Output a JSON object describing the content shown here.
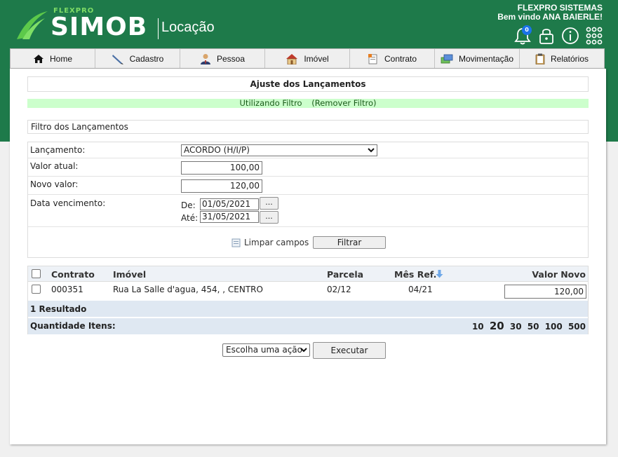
{
  "header": {
    "brand_small": "FLEXPRO",
    "brand_name": "SIMOB",
    "brand_sub": "Locação",
    "company": "FLEXPRO SISTEMAS",
    "welcome": "Bem vindo ANA BAIERLE!",
    "notifications_count": "0",
    "icons": [
      "bell-icon",
      "lock-icon",
      "info-icon",
      "apps-grid-icon"
    ]
  },
  "nav": {
    "items": [
      {
        "label": "Home",
        "icon": "home-icon"
      },
      {
        "label": "Cadastro",
        "icon": "pen-icon"
      },
      {
        "label": "Pessoa",
        "icon": "person-icon"
      },
      {
        "label": "Imóvel",
        "icon": "house-icon"
      },
      {
        "label": "Contrato",
        "icon": "document-icon"
      },
      {
        "label": "Movimentação",
        "icon": "money-icon"
      },
      {
        "label": "Relatórios",
        "icon": "clipboard-icon"
      }
    ]
  },
  "page": {
    "title": "Ajuste dos Lançamentos",
    "filter_status": "Utilizando Filtro",
    "remove_filter": "(Remover Filtro)",
    "section_title": "Filtro dos Lançamentos"
  },
  "form": {
    "lancamento_label": "Lançamento:",
    "lancamento_value": "ACORDO (H/I/P)",
    "valor_atual_label": "Valor atual:",
    "valor_atual_value": "100,00",
    "novo_valor_label": "Novo valor:",
    "novo_valor_value": "120,00",
    "data_venc_label": "Data vencimento:",
    "de_label": "De:",
    "de_value": "01/05/2021",
    "ate_label": "Até:",
    "ate_value": "31/05/2021",
    "picker_label": "...",
    "clear_label": "Limpar campos",
    "filter_button": "Filtrar"
  },
  "grid": {
    "columns": {
      "contrato": "Contrato",
      "imovel": "Imóvel",
      "parcela": "Parcela",
      "mes_ref": "Mês Ref.",
      "valor_novo": "Valor Novo"
    },
    "rows": [
      {
        "contrato": "000351",
        "imovel": "Rua La Salle d'agua, 454, , CENTRO",
        "parcela": "02/12",
        "mes_ref": "04/21",
        "valor_novo": "120,00"
      }
    ],
    "result_count": "1 Resultado",
    "qty_label": "Quantidade Itens:",
    "page_sizes": [
      "10",
      "20",
      "30",
      "50",
      "100",
      "500"
    ],
    "current_page_size": "20"
  },
  "actions": {
    "select_value": "Escolha uma ação",
    "execute_button": "Executar"
  },
  "colors": {
    "header_green": "#1e7a4a",
    "filter_bar": "#ccffcc",
    "grid_header": "#eef2f7",
    "grid_footer": "#dfe8f2"
  }
}
